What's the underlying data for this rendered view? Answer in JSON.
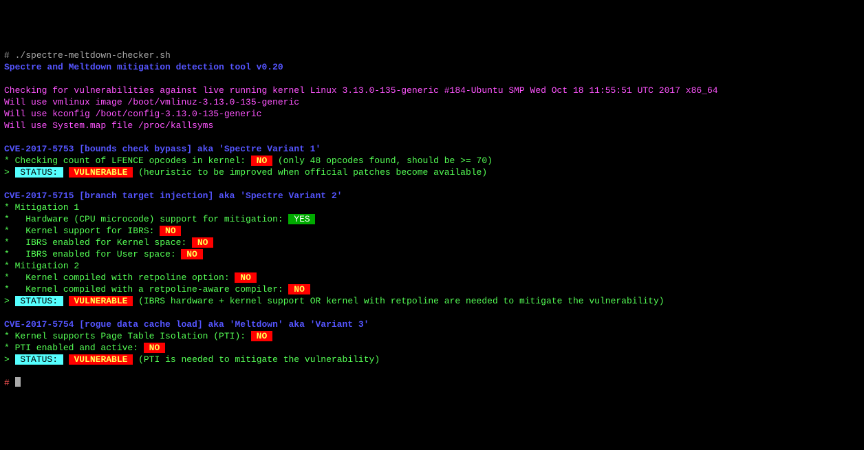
{
  "prompt1": "# ",
  "cmd": "./spectre-meltdown-checker.sh",
  "title": "Spectre and Meltdown mitigation detection tool v0.20",
  "blank": "",
  "check_intro": "Checking for vulnerabilities against live running kernel ",
  "kernel_info": "Linux 3.13.0-135-generic #184-Ubuntu SMP Wed Oct 18 11:55:51 UTC 2017 x86_64",
  "use_vmlinux": "Will use vmlinux image /boot/vmlinuz-3.13.0-135-generic",
  "use_kconfig": "Will use kconfig /boot/config-3.13.0-135-generic",
  "use_sysmap": "Will use System.map file /proc/kallsyms",
  "cve1_header": "CVE-2017-5753 [bounds check bypass] aka 'Spectre Variant 1'",
  "cve1_check_label": "* Checking count of LFENCE opcodes in kernel: ",
  "cve1_check_flag": " NO ",
  "cve1_check_note": " (only 48 opcodes found, should be >= 70)",
  "status_arrow": "> ",
  "status_label": " STATUS: ",
  "status_gap": " ",
  "vuln_flag": " VULNERABLE ",
  "cve1_status_note": " (heuristic to be improved when official patches become available)",
  "cve2_header": "CVE-2017-5715 [branch target injection] aka 'Spectre Variant 2'",
  "mit1": "* Mitigation 1",
  "mit1_hw_label": "*   Hardware (CPU microcode) support for mitigation: ",
  "yes_flag": " YES ",
  "mit1_ibrs_label": "*   Kernel support for IBRS: ",
  "no_flag": " NO ",
  "mit1_ibrs_k_label": "*   IBRS enabled for Kernel space: ",
  "mit1_ibrs_u_label": "*   IBRS enabled for User space: ",
  "mit2": "* Mitigation 2",
  "mit2_retpo_label": "*   Kernel compiled with retpoline option: ",
  "mit2_retcomp_label": "*   Kernel compiled with a retpoline-aware compiler: ",
  "cve2_status_note": " (IBRS hardware + kernel support OR kernel with retpoline are needed to mitigate the vulnerability)",
  "cve3_header": "CVE-2017-5754 [rogue data cache load] aka 'Meltdown' aka 'Variant 3'",
  "cve3_pti_label": "* Kernel supports Page Table Isolation (PTI): ",
  "cve3_pti_en_label": "* PTI enabled and active: ",
  "cve3_status_note": " (PTI is needed to mitigate the vulnerability)",
  "prompt2": "# "
}
